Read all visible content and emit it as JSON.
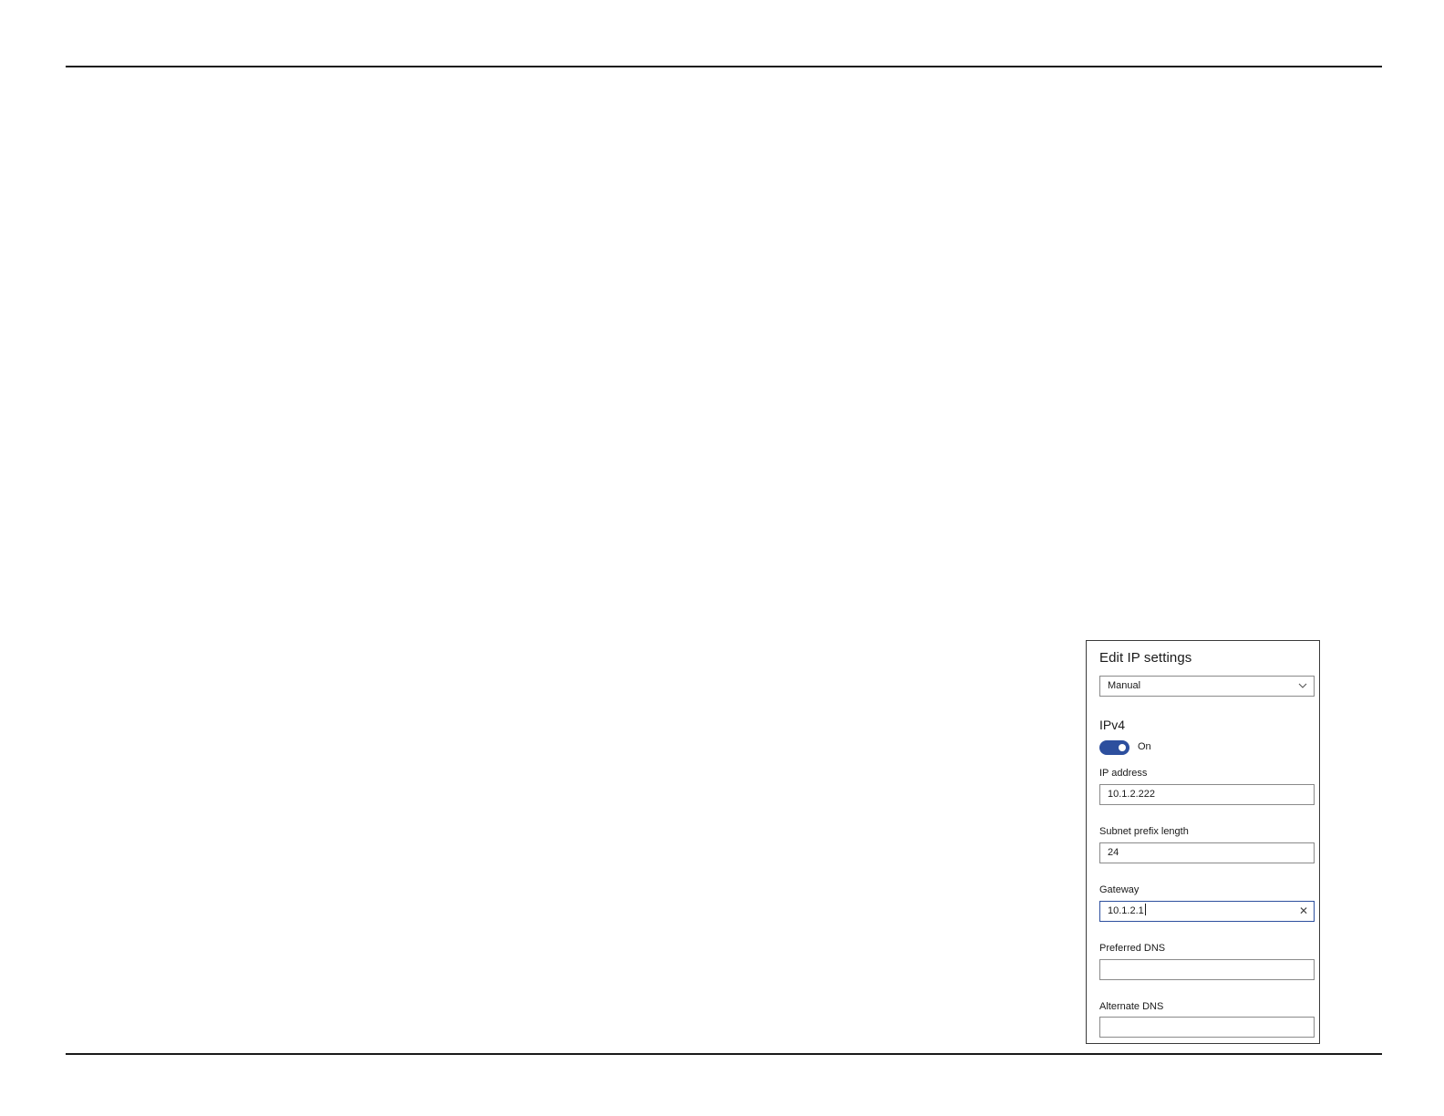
{
  "dialog": {
    "title": "Edit IP settings",
    "mode_select": {
      "value": "Manual"
    },
    "section": "IPv4",
    "toggle": {
      "state": "On",
      "enabled": true
    },
    "fields": {
      "ip_address": {
        "label": "IP address",
        "value": "10.1.2.222"
      },
      "subnet_prefix_length": {
        "label": "Subnet prefix length",
        "value": "24"
      },
      "gateway": {
        "label": "Gateway",
        "value": "10.1.2.1"
      },
      "preferred_dns": {
        "label": "Preferred DNS",
        "value": ""
      },
      "alternate_dns": {
        "label": "Alternate DNS",
        "value": ""
      }
    }
  },
  "icons": {
    "select_chevron": "chevron-down-icon",
    "clear_field": "close-icon"
  },
  "colors": {
    "accent": "#2d4f9e",
    "text": "#1a1a1a",
    "field_border": "#8a8a8a"
  }
}
